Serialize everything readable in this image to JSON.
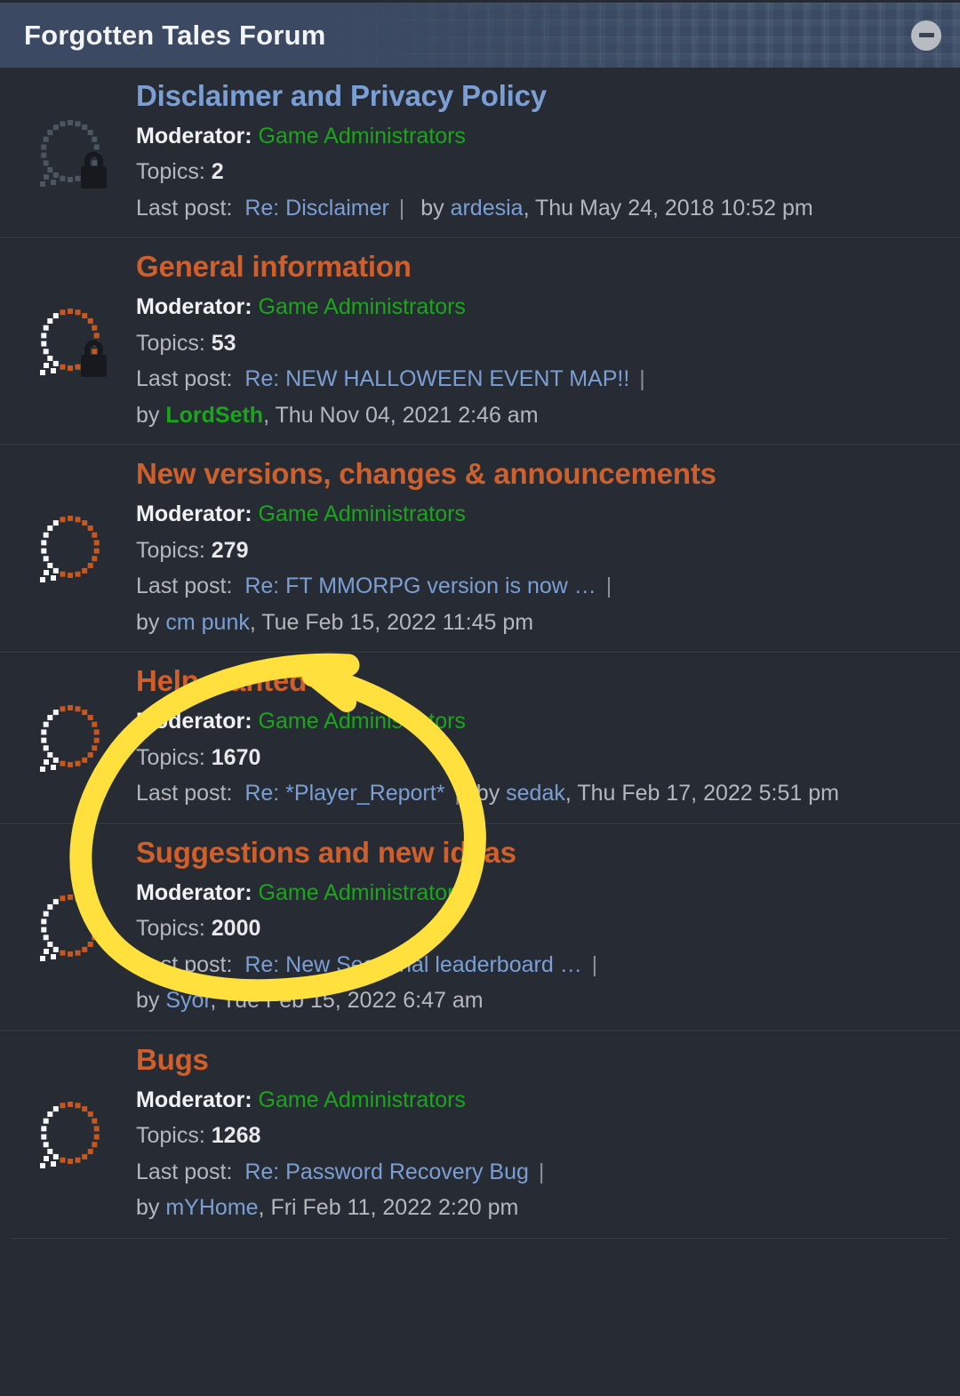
{
  "header": {
    "title": "Forgotten Tales Forum",
    "collapse_icon": "minus-circle-icon"
  },
  "labels": {
    "moderator": "Moderator:",
    "topics": "Topics:",
    "last_post": "Last post:",
    "by": "by",
    "separator": "|"
  },
  "colors": {
    "page_background": "#272c34",
    "header_background": "#3b4a62",
    "title_locked": "#7b9fd4",
    "title_open": "#cf5f2b",
    "moderator_name": "#1ba51b",
    "link": "#7b9fd4",
    "body_text": "#b4b8bd",
    "annotation": "#ffe03c"
  },
  "forums": [
    {
      "title": "Disclaimer and Privacy Policy",
      "title_color": "blue",
      "icon": "forum-locked-read-icon",
      "icon_variant": "gray",
      "locked": true,
      "moderator": "Game Administrators",
      "moderator_bold": false,
      "topics": "2",
      "last_post_subject": "Re: Disclaimer",
      "last_post_author": "ardesia",
      "last_post_author_color": "link",
      "last_post_date": "Thu May 24, 2018 10:52 pm",
      "wraps": false
    },
    {
      "title": "General information",
      "title_color": "orange",
      "icon": "forum-locked-unread-icon",
      "icon_variant": "orange",
      "locked": true,
      "moderator": "Game Administrators",
      "moderator_bold": false,
      "topics": "53",
      "last_post_subject": "Re: NEW HALLOWEEN EVENT MAP!!",
      "last_post_author": "LordSeth",
      "last_post_author_color": "green-bold",
      "last_post_date": "Thu Nov 04, 2021 2:46 am",
      "wraps": true
    },
    {
      "title": "New versions, changes & announcements",
      "title_color": "orange",
      "icon": "forum-unread-icon",
      "icon_variant": "orange",
      "locked": false,
      "moderator": "Game Administrators",
      "moderator_bold": false,
      "topics": "279",
      "last_post_subject": "Re: FT MMORPG version is now …",
      "last_post_author": "cm punk",
      "last_post_author_color": "link",
      "last_post_date": "Tue Feb 15, 2022 11:45 pm",
      "wraps": true
    },
    {
      "title": "Help wanted",
      "title_color": "orange",
      "icon": "forum-unread-icon",
      "icon_variant": "orange",
      "locked": false,
      "moderator": "Game Administrators",
      "moderator_bold": false,
      "topics": "1670",
      "last_post_subject": "Re: *Player_Report*",
      "last_post_author": "sedak",
      "last_post_author_color": "link",
      "last_post_date": "Thu Feb 17, 2022 5:51 pm",
      "wraps": false,
      "highlighted": true
    },
    {
      "title": "Suggestions and new ideas",
      "title_color": "orange",
      "icon": "forum-unread-icon",
      "icon_variant": "orange",
      "locked": false,
      "moderator": "Game Administrators",
      "moderator_bold": false,
      "topics": "2000",
      "last_post_subject": "Re: New Seasonal leaderboard …",
      "last_post_author": "Syor",
      "last_post_author_color": "link",
      "last_post_date": "Tue Feb 15, 2022 6:47 am",
      "wraps": true
    },
    {
      "title": "Bugs",
      "title_color": "orange",
      "icon": "forum-unread-icon",
      "icon_variant": "orange",
      "locked": false,
      "moderator": "Game Administrators",
      "moderator_bold": false,
      "topics": "1268",
      "last_post_subject": "Re: Password Recovery Bug",
      "last_post_author": "mYHome",
      "last_post_author_color": "link",
      "last_post_date": "Fri Feb 11, 2022 2:20 pm",
      "wraps": true
    }
  ],
  "annotation": {
    "shape": "hand-drawn-ellipse",
    "target": "Help wanted",
    "color": "#ffe03c"
  }
}
